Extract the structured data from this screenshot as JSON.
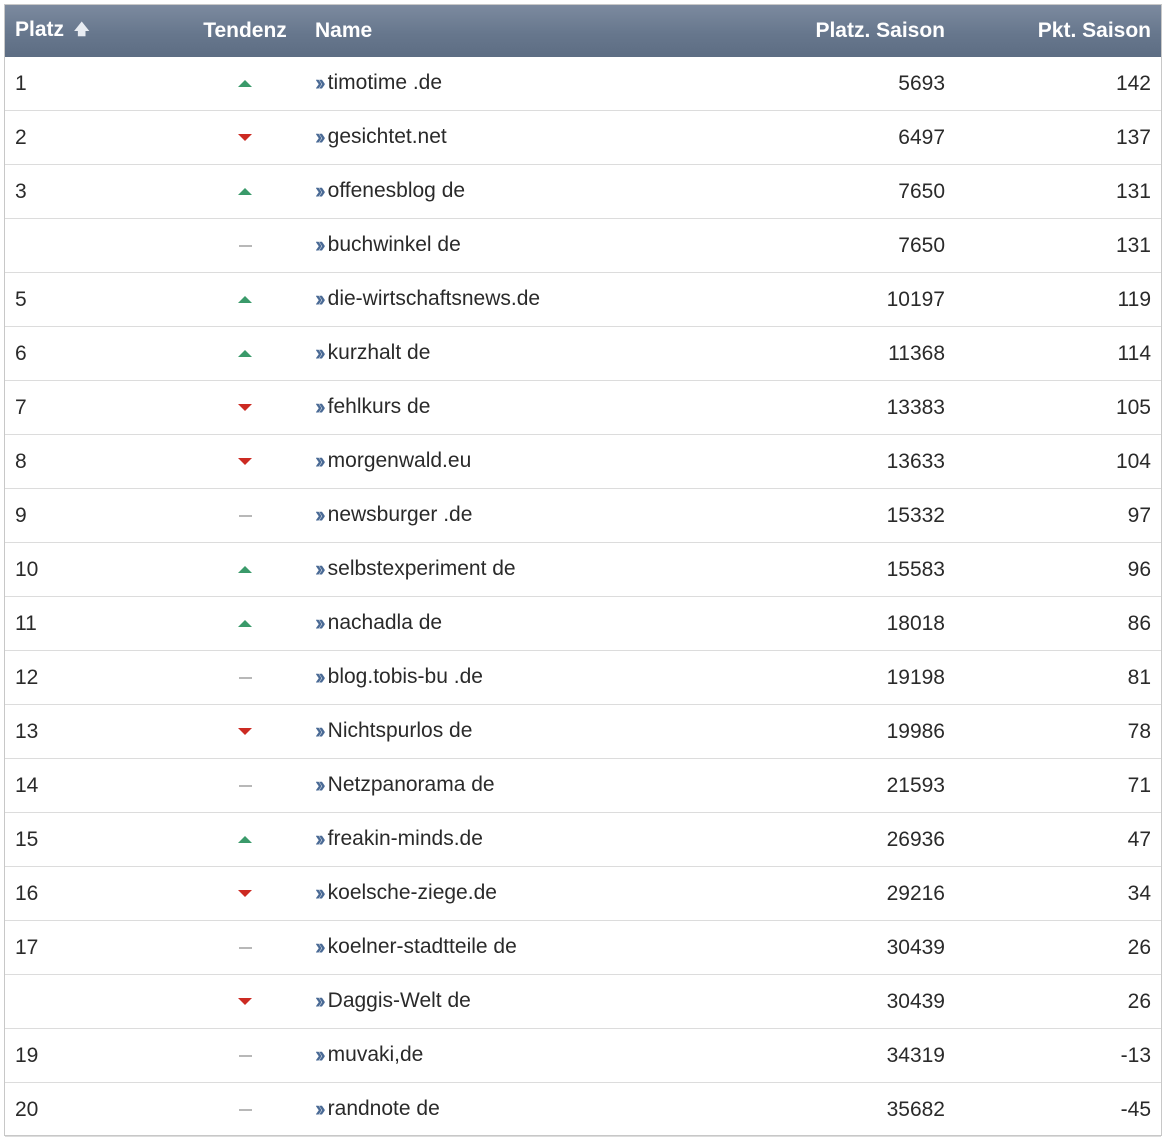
{
  "table": {
    "headers": {
      "platz": "Platz",
      "tendenz": "Tendenz",
      "name": "Name",
      "platz_saison": "Platz. Saison",
      "pkt_saison": "Pkt. Saison"
    },
    "sort": {
      "column": "platz",
      "direction": "ascending",
      "icon": "sort-up-arrow-icon"
    },
    "colors": {
      "up": "#3a9a6a",
      "down": "#cc2a22",
      "same": "#b8b8b8",
      "header": "#67778d",
      "link_icon": "#4a6a95"
    },
    "rows": [
      {
        "platz": "1",
        "trend": "up",
        "name": "timotime .de",
        "platz_saison": "5693",
        "pkt_saison": "142"
      },
      {
        "platz": "2",
        "trend": "down",
        "name": "gesichtet.net",
        "platz_saison": "6497",
        "pkt_saison": "137"
      },
      {
        "platz": "3",
        "trend": "up",
        "name": "offenesblog de",
        "platz_saison": "7650",
        "pkt_saison": "131"
      },
      {
        "platz": "",
        "trend": "same",
        "name": "buchwinkel de",
        "platz_saison": "7650",
        "pkt_saison": "131"
      },
      {
        "platz": "5",
        "trend": "up",
        "name": "die-wirtschaftsnews.de",
        "platz_saison": "10197",
        "pkt_saison": "119"
      },
      {
        "platz": "6",
        "trend": "up",
        "name": "kurzhalt de",
        "platz_saison": "11368",
        "pkt_saison": "114"
      },
      {
        "platz": "7",
        "trend": "down",
        "name": "fehlkurs de",
        "platz_saison": "13383",
        "pkt_saison": "105"
      },
      {
        "platz": "8",
        "trend": "down",
        "name": "morgenwald.eu",
        "platz_saison": "13633",
        "pkt_saison": "104"
      },
      {
        "platz": "9",
        "trend": "same",
        "name": "newsburger .de",
        "platz_saison": "15332",
        "pkt_saison": "97"
      },
      {
        "platz": "10",
        "trend": "up",
        "name": "selbstexperiment de",
        "platz_saison": "15583",
        "pkt_saison": "96"
      },
      {
        "platz": "11",
        "trend": "up",
        "name": "nachadla de",
        "platz_saison": "18018",
        "pkt_saison": "86"
      },
      {
        "platz": "12",
        "trend": "same",
        "name": "blog.tobis-bu .de",
        "platz_saison": "19198",
        "pkt_saison": "81"
      },
      {
        "platz": "13",
        "trend": "down",
        "name": "Nichtspurlos de",
        "platz_saison": "19986",
        "pkt_saison": "78"
      },
      {
        "platz": "14",
        "trend": "same",
        "name": "Netzpanorama de",
        "platz_saison": "21593",
        "pkt_saison": "71"
      },
      {
        "platz": "15",
        "trend": "up",
        "name": "freakin-minds.de",
        "platz_saison": "26936",
        "pkt_saison": "47"
      },
      {
        "platz": "16",
        "trend": "down",
        "name": "koelsche-ziege.de",
        "platz_saison": "29216",
        "pkt_saison": "34"
      },
      {
        "platz": "17",
        "trend": "same",
        "name": "koelner-stadtteile de",
        "platz_saison": "30439",
        "pkt_saison": "26"
      },
      {
        "platz": "",
        "trend": "down",
        "name": "Daggis-Welt de",
        "platz_saison": "30439",
        "pkt_saison": "26"
      },
      {
        "platz": "19",
        "trend": "same",
        "name": "muvaki,de",
        "platz_saison": "34319",
        "pkt_saison": "-13"
      },
      {
        "platz": "20",
        "trend": "same",
        "name": "randnote de",
        "platz_saison": "35682",
        "pkt_saison": "-45"
      }
    ]
  }
}
